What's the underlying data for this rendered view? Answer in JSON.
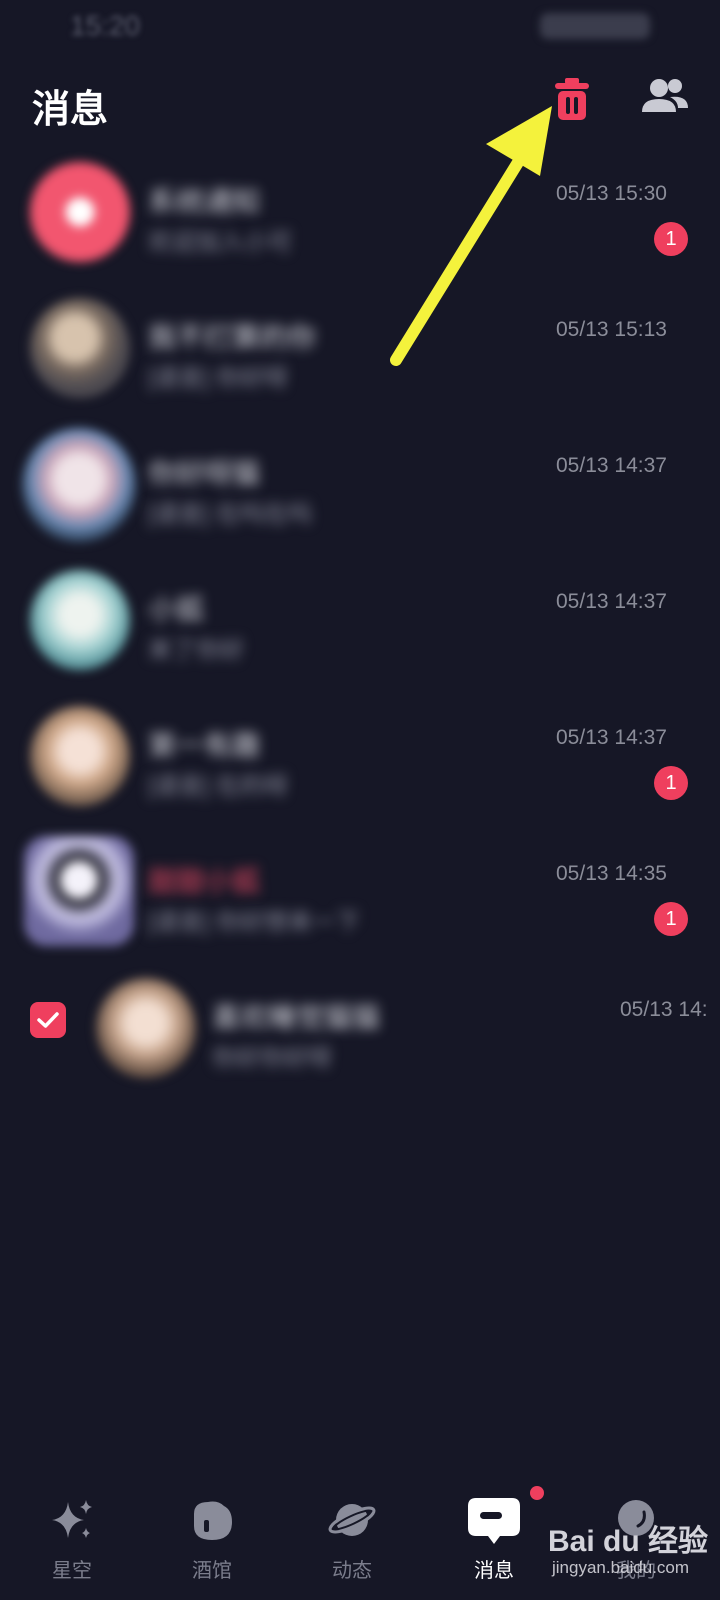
{
  "status_bar": {
    "time": "15:20"
  },
  "header": {
    "title": "消息"
  },
  "messages": [
    {
      "name": "系统通知",
      "preview": "欢迎加入小可",
      "time": "05/13 15:30",
      "badge": "1",
      "avatar_color": "#f2566f",
      "name_color": "#d9dae2"
    },
    {
      "name": "我不打算的你",
      "preview": "[语音] 你好呀",
      "time": "05/13 15:13",
      "badge": "",
      "avatar_color": "#8a7d73",
      "name_color": "#d9dae2"
    },
    {
      "name": "你好呀猫",
      "preview": "[语音] 在吗在吗",
      "time": "05/13 14:37",
      "badge": "",
      "avatar_color": "#b79aa9",
      "name_color": "#d9dae2"
    },
    {
      "name": "小狐",
      "preview": "来了你好",
      "time": "05/13 14:37",
      "badge": "",
      "avatar_color": "#9fcdd0",
      "name_color": "#d9dae2"
    },
    {
      "name": "第一有趣",
      "preview": "[语音] 在的呀",
      "time": "05/13 14:37",
      "badge": "1",
      "avatar_color": "#c9a891",
      "name_color": "#d9dae2"
    },
    {
      "name": "甜甜小狐",
      "preview": "[语音] 你好想来一下",
      "time": "05/13 14:35",
      "badge": "1",
      "avatar_color": "#9a9db8",
      "name_color": "#e84a63"
    },
    {
      "name": "喜欢睡觉猫猫",
      "preview": "你好你好呀",
      "time": "05/13 14:",
      "badge": "",
      "avatar_color": "#c7a790",
      "name_color": "#d9dae2",
      "checked": true
    }
  ],
  "tabs": [
    {
      "label": "星空",
      "icon": "sparkle-icon",
      "active": false
    },
    {
      "label": "酒馆",
      "icon": "tavern-icon",
      "active": false
    },
    {
      "label": "动态",
      "icon": "planet-icon",
      "active": false
    },
    {
      "label": "消息",
      "icon": "message-icon",
      "active": true,
      "dot": true
    },
    {
      "label": "我的",
      "icon": "profile-icon",
      "active": false
    }
  ],
  "watermark": {
    "brand": "Bai du 经验",
    "url": "jingyan.baidu.com"
  },
  "colors": {
    "background": "#161726",
    "accent": "#ef3f5e",
    "arrow": "#f4f23c"
  }
}
